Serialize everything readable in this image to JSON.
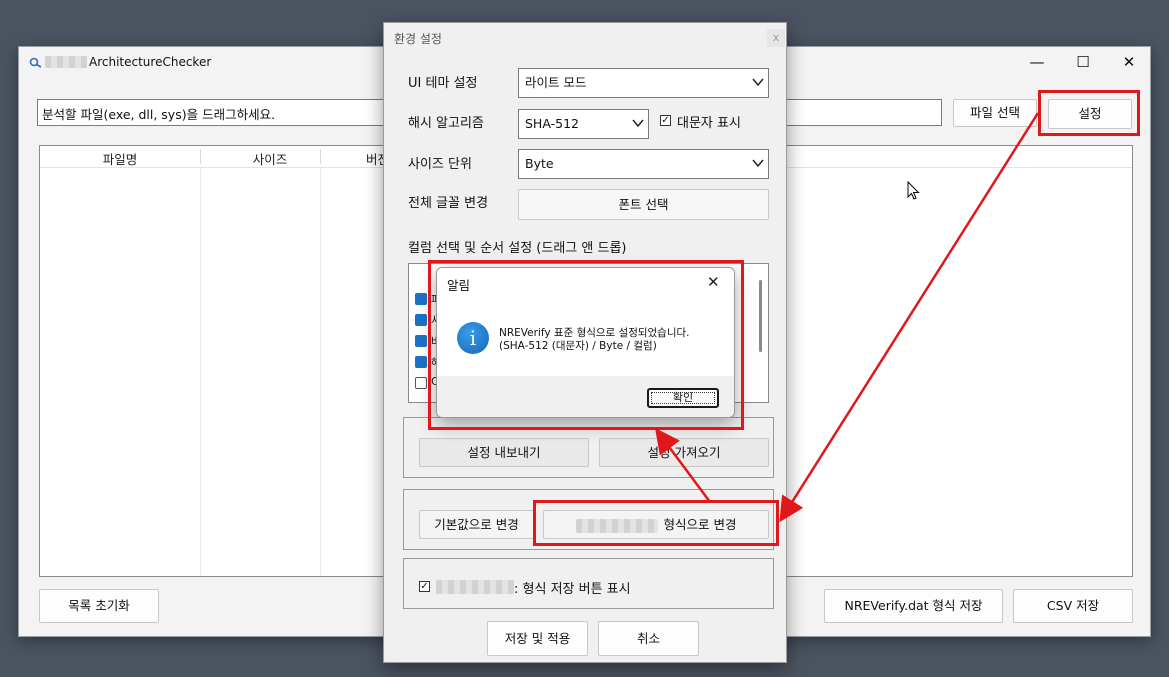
{
  "main_window": {
    "title": "ArchitectureChecker",
    "minimize_icon": "minimize-icon",
    "maximize_icon": "maximize-icon",
    "close_icon": "close-icon",
    "drop_prompt": "분석할 파일(exe, dll, sys)을 드래그하세요.",
    "file_select_label": "파일 선택",
    "settings_label": "설정",
    "columns": [
      "파일명",
      "사이즈",
      "버전"
    ],
    "reset_label": "목록 초기화",
    "nre_save_label": "NREVerify.dat 형식 저장",
    "csv_save_label": "CSV 저장"
  },
  "settings_dialog": {
    "title": "환경 설정",
    "close_glyph": "x",
    "theme_label": "UI 테마 설정",
    "theme_value": "라이트 모드",
    "hash_label": "해시 알고리즘",
    "hash_value": "SHA-512",
    "uppercase_label": "대문자 표시",
    "uppercase_checked": true,
    "size_unit_label": "사이즈 단위",
    "size_unit_value": "Byte",
    "font_label": "전체 글꼴 변경",
    "font_button": "폰트 선택",
    "columns_label": "컬럼 선택 및 순서 설정 (드래그 앤 드롭)",
    "column_items": [
      {
        "partial": "파",
        "checked": true
      },
      {
        "partial": "사",
        "checked": true
      },
      {
        "partial": "버",
        "checked": true
      },
      {
        "partial": "해",
        "checked": true
      },
      {
        "partial": "C",
        "checked": false
      }
    ],
    "export_button": "설정 내보내기",
    "import_button": "설정 가져오기",
    "default_button": "기본값으로 변경",
    "format_button": "형식으로 변경",
    "show_save_label": ": 형식 저장 버튼 표시",
    "show_save_checked": true,
    "save_apply_button": "저장 및 적용",
    "cancel_button": "취소"
  },
  "alert": {
    "title": "알림",
    "close_glyph": "✕",
    "icon": "info-icon",
    "message_line1": "NREVerify 표준 형식으로 설정되었습니다.",
    "message_line2": "(SHA-512 (대문자) / Byte / 컬럼)",
    "ok_button": "확인"
  },
  "colors": {
    "annotation_red": "#e0171b",
    "checkbox_blue": "#1a73c7",
    "info_blue": "#1a73c7"
  }
}
